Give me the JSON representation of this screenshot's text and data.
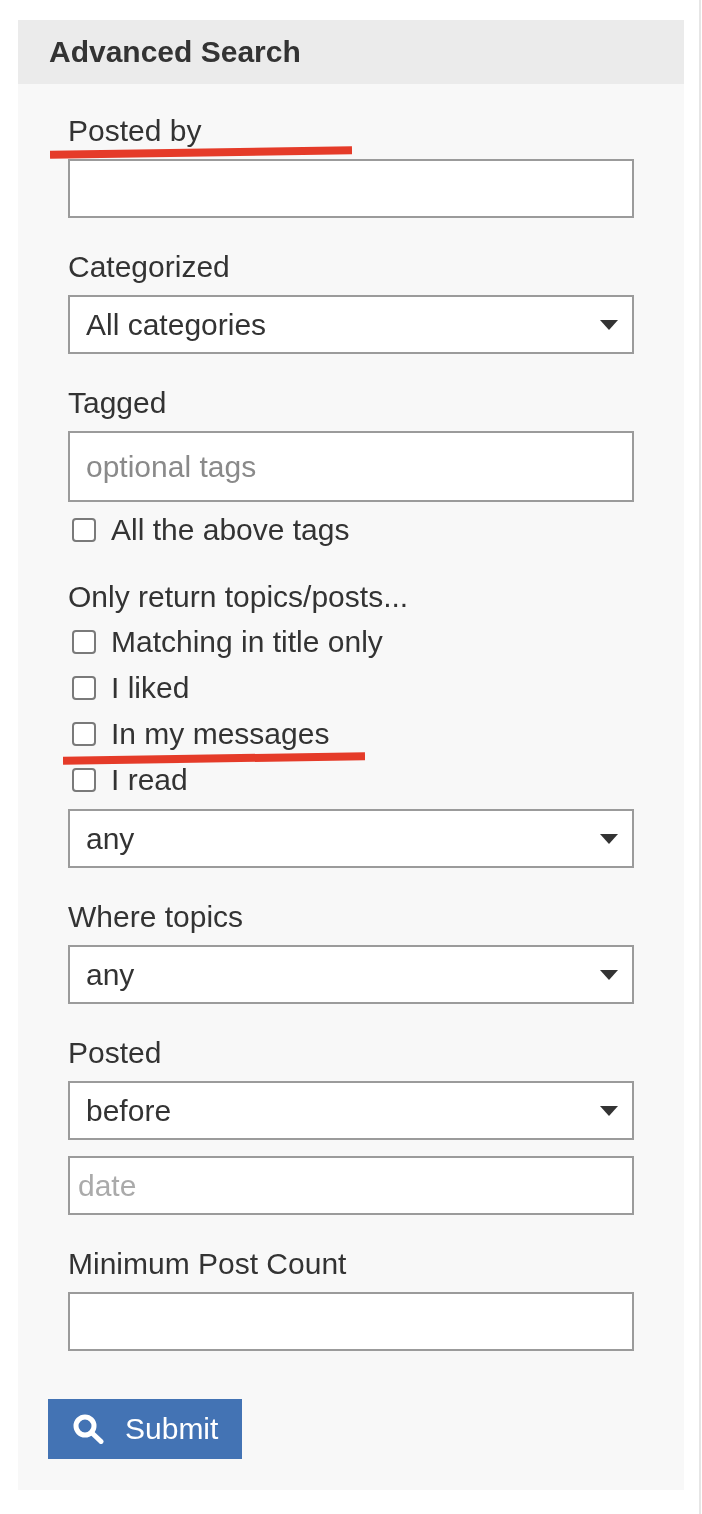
{
  "panel": {
    "title": "Advanced Search"
  },
  "fields": [
    {
      "kind": "text",
      "label": "Posted by",
      "annotated": true
    },
    {
      "kind": "select",
      "label": "Categorized",
      "value": "All categories",
      "annotated": false
    },
    {
      "kind": "tags",
      "label": "Tagged",
      "placeholder": "optional tags",
      "annotated": false
    },
    {
      "kind": "checkbox",
      "label": "All the above tags",
      "checked": false,
      "annotated": false
    },
    {
      "kind": "heading",
      "label": "Only return topics/posts...",
      "annotated": false
    },
    {
      "kind": "checkbox",
      "label": "Matching in title only",
      "checked": false,
      "annotated": false
    },
    {
      "kind": "checkbox",
      "label": "I liked",
      "checked": false,
      "annotated": false
    },
    {
      "kind": "checkbox",
      "label": "In my messages",
      "checked": false,
      "annotated": true
    },
    {
      "kind": "checkbox",
      "label": "I read",
      "checked": false,
      "annotated": false
    },
    {
      "kind": "select",
      "value": "any",
      "annotated": false
    },
    {
      "kind": "select",
      "label": "Where topics",
      "value": "any",
      "annotated": false
    },
    {
      "kind": "select",
      "label": "Posted",
      "value": "before",
      "annotated": false
    },
    {
      "kind": "text",
      "placeholder": "date",
      "annotated": false
    },
    {
      "kind": "text",
      "label": "Minimum Post Count",
      "annotated": false
    }
  ],
  "submit": {
    "label": "Submit"
  }
}
